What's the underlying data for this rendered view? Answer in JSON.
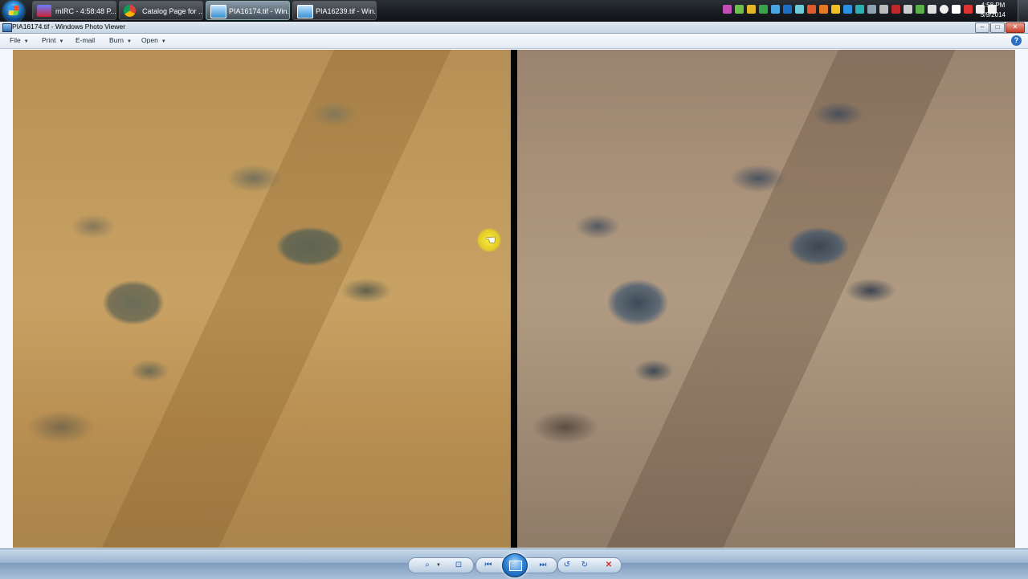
{
  "taskbar": {
    "tasks": [
      {
        "label": "mIRC - 4:58:48 P..."
      },
      {
        "label": "Catalog Page for ..."
      },
      {
        "label": "PIA16174.tif - Win..."
      },
      {
        "label": "PIA16239.tif - Win..."
      }
    ],
    "clock": {
      "time": "4:58 PM",
      "date": "5/9/2014"
    }
  },
  "window": {
    "title": "PIA16174.tif - Windows Photo Viewer",
    "controls": {
      "minimize": "–",
      "maximize": "□",
      "close": "✕"
    }
  },
  "menu": {
    "items": [
      {
        "label": "File"
      },
      {
        "label": "Print"
      },
      {
        "label": "E-mail"
      },
      {
        "label": "Burn"
      },
      {
        "label": "Open"
      }
    ],
    "help": "?"
  },
  "icons": {
    "zoom": "zoom-icon",
    "fit": "actual-size-icon",
    "previous": "previous-icon",
    "slideshow": "slideshow-icon",
    "next": "next-icon",
    "rotate_ccw": "rotate-counterclockwise-icon",
    "rotate_cw": "rotate-clockwise-icon",
    "delete": "delete-icon"
  },
  "colors": {
    "accent": "#2a6fc2",
    "delete": "#d0312d",
    "cursor_highlight": "#f0dc2a"
  }
}
